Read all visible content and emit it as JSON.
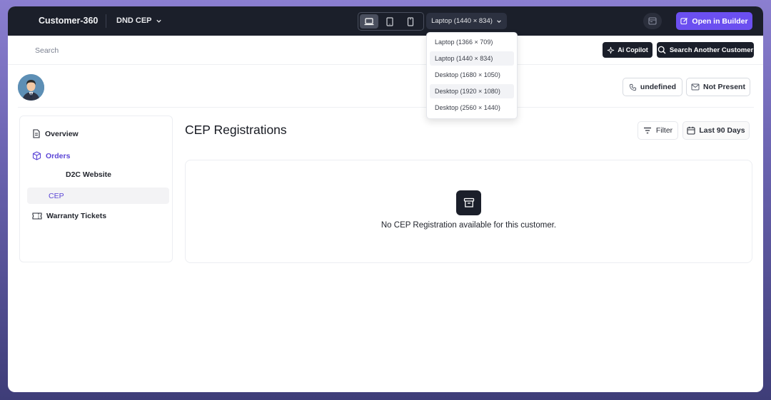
{
  "topbar": {
    "app_title": "Customer-360",
    "project_label": "DND CEP",
    "viewport_label": "Laptop (1440 × 834)",
    "open_builder_label": "Open in Builder",
    "accent_color": "#6b4ff0"
  },
  "viewport_menu": {
    "options": [
      "Laptop (1366 × 709)",
      "Laptop (1440 × 834)",
      "Desktop (1680 × 1050)",
      "Desktop (1920 × 1080)",
      "Desktop (2560 × 1440)"
    ]
  },
  "search": {
    "placeholder": "Search",
    "ai_copilot_label": "Ai Copilot",
    "search_customer_label": "Search Another Customer"
  },
  "profile": {
    "phone_label": "undefined",
    "email_label": "Not Present"
  },
  "sidebar": {
    "overview": "Overview",
    "orders": "Orders",
    "d2c": "D2C Website",
    "cep": "CEP",
    "warranty": "Warranty Tickets"
  },
  "main": {
    "title": "CEP Registrations",
    "filter_label": "Filter",
    "date_label": "Last 90 Days",
    "empty_message": "No CEP Registration available for this customer."
  }
}
